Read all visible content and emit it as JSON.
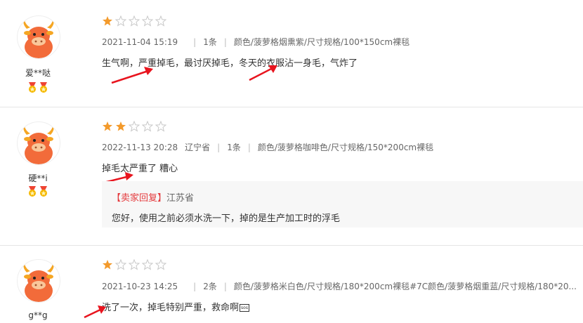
{
  "reviews": [
    {
      "username": "爱**哒",
      "medal_count": 2,
      "rating": 1,
      "max_rating": 5,
      "date": "2021-11-04 15:19",
      "region": "",
      "count": "1条",
      "spec": "颜色/菠萝格烟熏紫/尺寸规格/100*150cm裸毯",
      "content": "生气啊，严重掉毛，最讨厌掉毛，冬天的衣服沾一身毛，气炸了"
    },
    {
      "username": "硬**i",
      "medal_count": 2,
      "rating": 2,
      "max_rating": 5,
      "date": "2022-11-13 20:28",
      "region": "辽宁省",
      "count": "1条",
      "spec": "颜色/菠萝格咖啡色/尺寸规格/150*200cm裸毯",
      "content": "掉毛太严重了 糟心",
      "reply": {
        "tag": "【卖家回复】",
        "region": "江苏省",
        "text": "您好，使用之前必须水洗一下，掉的是生产加工时的浮毛"
      }
    },
    {
      "username": "g**g",
      "medal_count": 0,
      "rating": 1,
      "max_rating": 5,
      "date": "2021-10-23 14:25",
      "region": "",
      "count": "2条",
      "spec": "颜色/菠萝格米白色/尺寸规格/180*200cm裸毯#7C颜色/菠萝格烟重蓝/尺寸规格/180*20...",
      "content": "洗了一次，掉毛特别严重，救命啊",
      "content_glyph": "sos"
    }
  ],
  "colors": {
    "star_filled": "#f39a2b",
    "star_empty": "#c8c8c8",
    "arrow": "#e8141e",
    "reply_tag": "#e4393c",
    "avatar": "#f26b3a"
  },
  "icons": {
    "avatar": "cow-avatar-icon",
    "medal": "medal-icon",
    "star": "star-icon",
    "arrow": "annotation-arrow"
  }
}
